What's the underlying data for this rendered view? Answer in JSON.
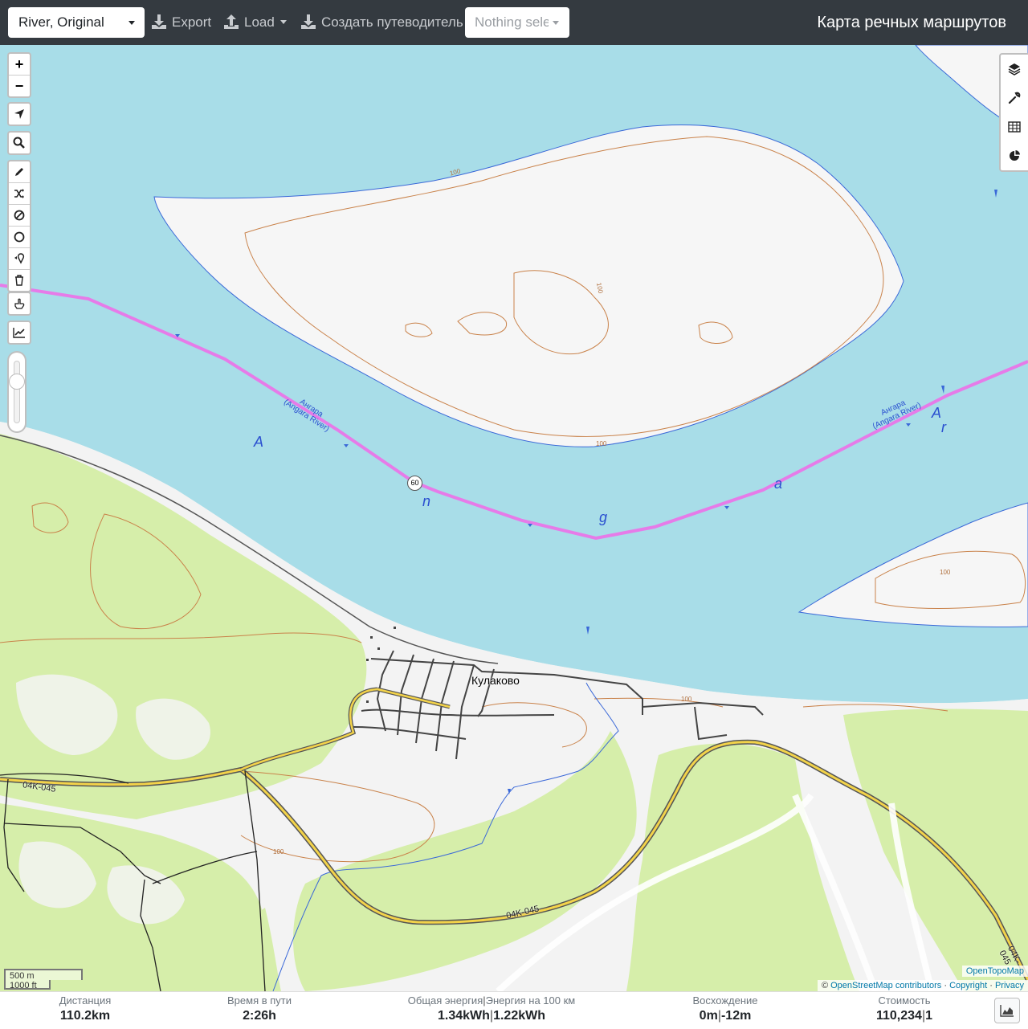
{
  "header": {
    "profile_select": "River, Original",
    "export_label": "Export",
    "load_label": "Load",
    "guide_label": "Создать путеводитель",
    "segment_select_placeholder": "Nothing selected",
    "brand_title": "Карта речных маршрутов"
  },
  "map": {
    "village_label": "Кулаково",
    "river_label_ru": "Ангара",
    "river_label_en": "(Angara River)",
    "route_number_badge": "60",
    "road_label": "04K-045",
    "contour_label": "100",
    "river_letters": [
      "A",
      "n",
      "g",
      "a",
      "A",
      "r"
    ],
    "route_color": "#e67be8",
    "water_color": "#a8dde8",
    "forest_color": "#d6eeaa"
  },
  "map_controls": {
    "zoom_in": "+",
    "zoom_out": "−",
    "left_tools": [
      "locate-icon",
      "search-icon",
      "draw-icon",
      "shuffle-icon",
      "no-entry-icon",
      "circle-icon",
      "pin-icon",
      "trash-icon",
      "hand-icon",
      "chart-icon"
    ],
    "right_tools": [
      "layers-icon",
      "wrench-icon",
      "table-icon",
      "pie-chart-icon"
    ]
  },
  "scale": {
    "metric": "500 m",
    "imperial": "1000 ft"
  },
  "attribution": {
    "tiles": "OpenTopoMap",
    "copyright_symbol": "©",
    "osm": "OpenStreetMap contributors",
    "copyright_link": "Copyright",
    "privacy_link": "Privacy"
  },
  "stats": {
    "distance": {
      "label": "Дистанция",
      "value": "110.2",
      "unit": "km"
    },
    "time": {
      "label": "Время в пути",
      "value": "2:26",
      "unit": "h"
    },
    "energy": {
      "label": "Общая энергия",
      "label2": "Энергия на 100 км",
      "value": "1.34",
      "unit": "kWh",
      "value2": "1.22",
      "unit2": "kWh"
    },
    "ascent": {
      "label": "Восхождение",
      "value": "0",
      "unit": "m",
      "value2": "-12",
      "unit2": "m"
    },
    "cost": {
      "label": "Стоимость",
      "value": "110,234",
      "value2": "1"
    }
  }
}
